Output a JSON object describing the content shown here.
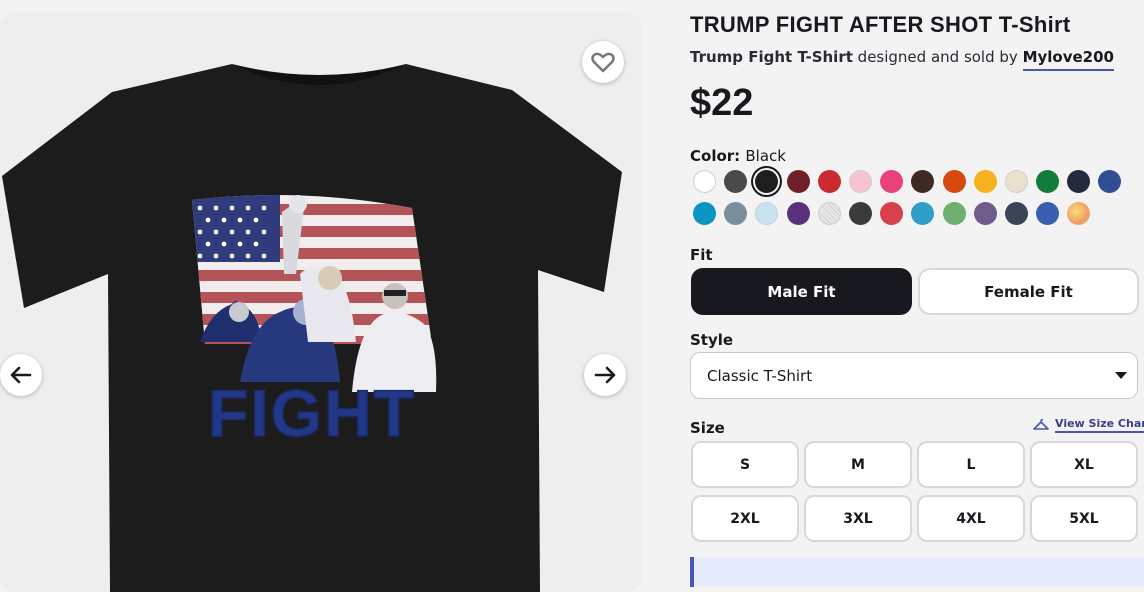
{
  "product": {
    "title": "TRUMP FIGHT AFTER SHOT T-Shirt",
    "design_name": "Trump Fight T-Shirt",
    "byline": "designed and sold by",
    "artist": "Mylove200",
    "price": "$22",
    "image_text": "FIGHT"
  },
  "icons": {
    "favorite": "heart-icon",
    "prev": "arrow-left-icon",
    "next": "arrow-right-icon",
    "size_chart": "hanger-icon",
    "dropdown": "caret-down-icon"
  },
  "color": {
    "label": "Color:",
    "selected": "Black",
    "swatches": [
      "#ffffff",
      "#4a4a4a",
      "#1e1e1e",
      "#6e1f28",
      "#c9292f",
      "#f7c3cf",
      "#e8417c",
      "#3e2a22",
      "#d9480f",
      "#f6b11f",
      "#e9e1cd",
      "#127d3a",
      "#232a3d",
      "#2e4f95",
      "#0c94c2",
      "#7b8e9b",
      "#c9e2f0",
      "#5a2f7c",
      "#e8e8e8",
      "#3a3a3a",
      "#d8404b",
      "#2e9fc8",
      "#70b06f",
      "#715b8c",
      "#3b4556",
      "#3a5fb0",
      "#f6c36a"
    ],
    "selected_index": 2
  },
  "fit": {
    "label": "Fit",
    "options": [
      "Male Fit",
      "Female Fit"
    ],
    "selected": "Male Fit"
  },
  "style": {
    "label": "Style",
    "value": "Classic T-Shirt"
  },
  "size": {
    "label": "Size",
    "chart_link": "View Size Chart",
    "options": [
      "S",
      "M",
      "L",
      "XL",
      "2XL",
      "3XL",
      "4XL",
      "5XL"
    ]
  }
}
